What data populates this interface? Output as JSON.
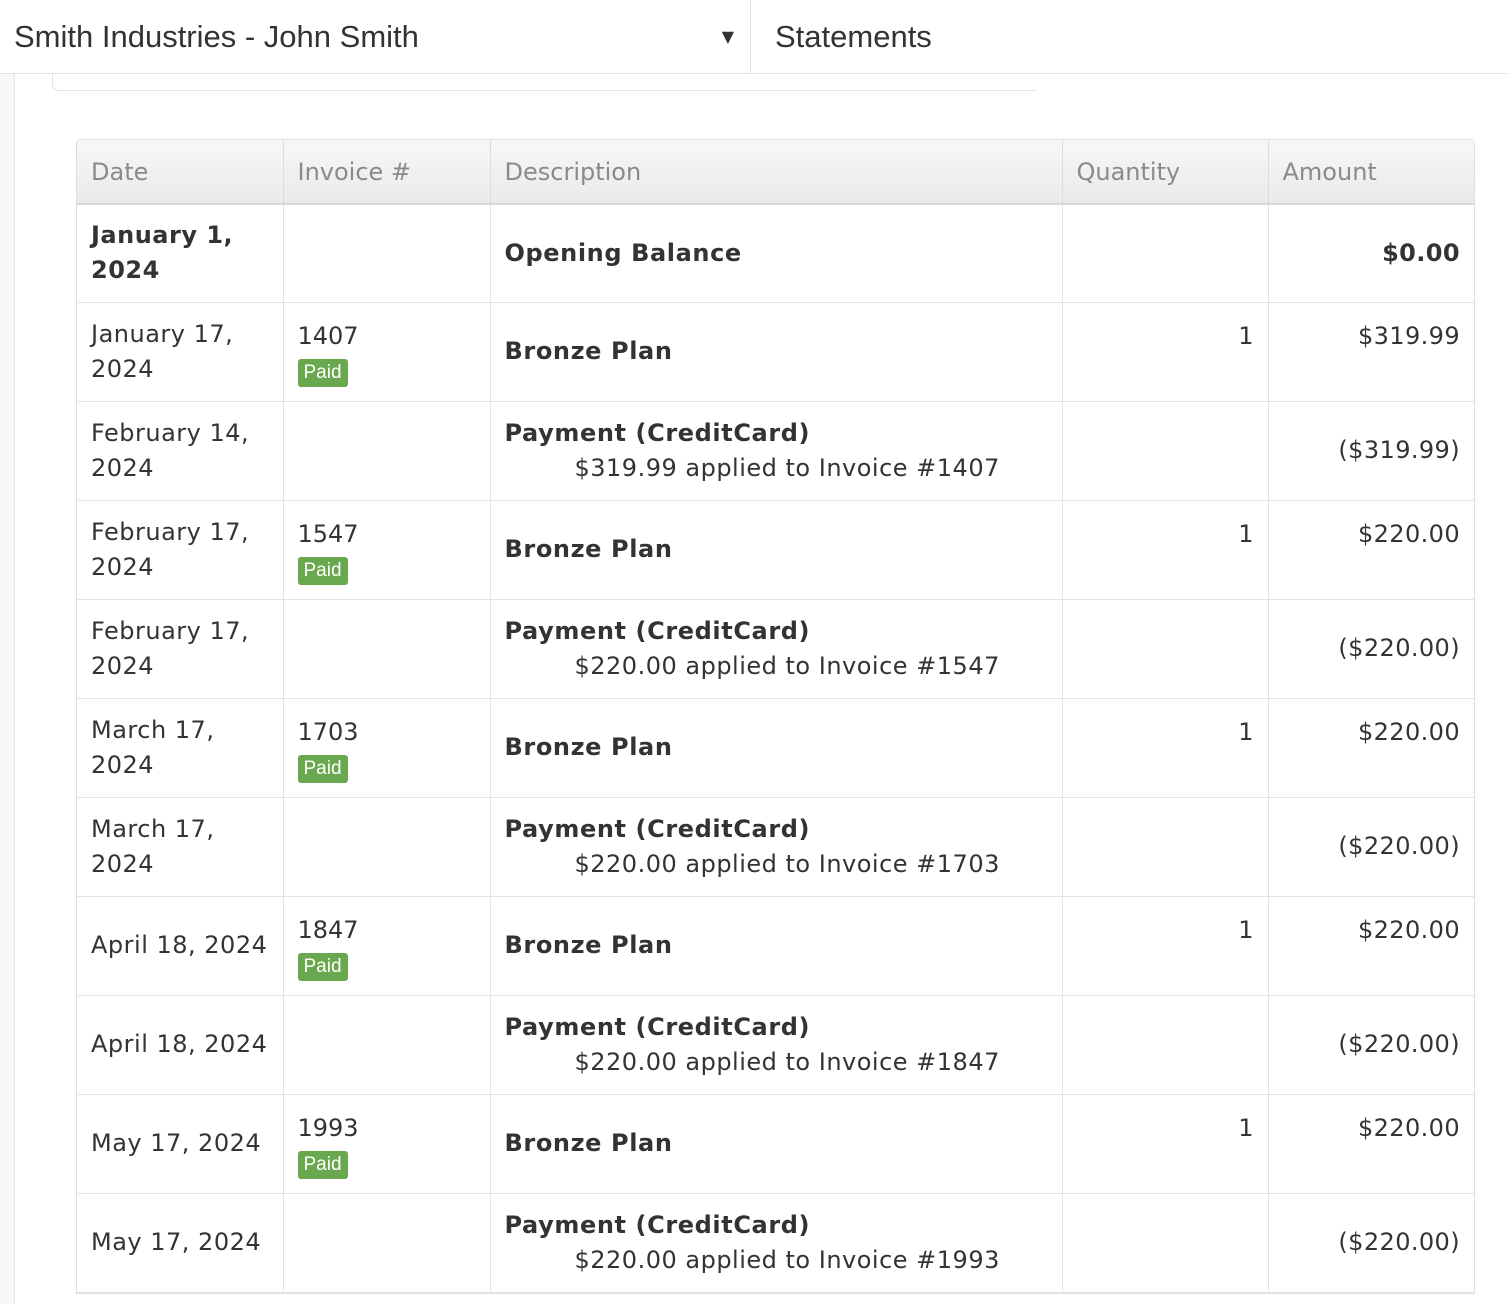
{
  "header": {
    "account_name": "Smith Industries - John Smith",
    "page_title": "Statements"
  },
  "table": {
    "columns": [
      "Date",
      "Invoice #",
      "Description",
      "Quantity",
      "Amount"
    ],
    "opening": {
      "date": "January 1, 2024",
      "description": "Opening Balance",
      "amount": "$0.00"
    },
    "rows": [
      {
        "date": "January 17, 2024",
        "invoice": "1407",
        "status": "Paid",
        "title": "Bronze Plan",
        "detail": "",
        "quantity": "1",
        "amount": "$319.99"
      },
      {
        "date": "February 14, 2024",
        "invoice": "",
        "status": "",
        "title": "Payment (CreditCard)",
        "detail": "$319.99 applied to Invoice #1407",
        "quantity": "",
        "amount": "($319.99)"
      },
      {
        "date": "February 17, 2024",
        "invoice": "1547",
        "status": "Paid",
        "title": "Bronze Plan",
        "detail": "",
        "quantity": "1",
        "amount": "$220.00"
      },
      {
        "date": "February 17, 2024",
        "invoice": "",
        "status": "",
        "title": "Payment (CreditCard)",
        "detail": "$220.00 applied to Invoice #1547",
        "quantity": "",
        "amount": "($220.00)"
      },
      {
        "date": "March 17, 2024",
        "invoice": "1703",
        "status": "Paid",
        "title": "Bronze Plan",
        "detail": "",
        "quantity": "1",
        "amount": "$220.00"
      },
      {
        "date": "March 17, 2024",
        "invoice": "",
        "status": "",
        "title": "Payment (CreditCard)",
        "detail": "$220.00 applied to Invoice #1703",
        "quantity": "",
        "amount": "($220.00)"
      },
      {
        "date": "April 18, 2024",
        "invoice": "1847",
        "status": "Paid",
        "title": "Bronze Plan",
        "detail": "",
        "quantity": "1",
        "amount": "$220.00"
      },
      {
        "date": "April 18, 2024",
        "invoice": "",
        "status": "",
        "title": "Payment (CreditCard)",
        "detail": "$220.00 applied to Invoice #1847",
        "quantity": "",
        "amount": "($220.00)"
      },
      {
        "date": "May 17, 2024",
        "invoice": "1993",
        "status": "Paid",
        "title": "Bronze Plan",
        "detail": "",
        "quantity": "1",
        "amount": "$220.00"
      },
      {
        "date": "May 17, 2024",
        "invoice": "",
        "status": "",
        "title": "Payment (CreditCard)",
        "detail": "$220.00 applied to Invoice #1993",
        "quantity": "",
        "amount": "($220.00)"
      }
    ]
  },
  "icons": {
    "account_dropdown": "caret-down-icon"
  },
  "colors": {
    "paid_badge": "#6aa84f",
    "header_text": "#8a8a8a"
  }
}
